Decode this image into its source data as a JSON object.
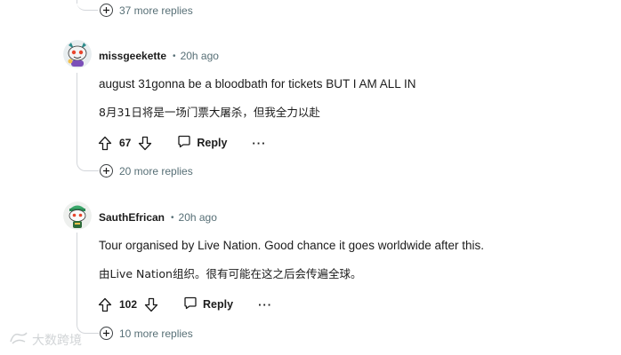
{
  "thread": {
    "top_more_replies": "37 more replies",
    "comments": [
      {
        "username": "missgeekette",
        "separator": "•",
        "time": "20h ago",
        "text": "august 31gonna be a bloodbath for tickets BUT I AM ALL IN",
        "translation": "8月31日将是一场门票大屠杀，但我全力以赴",
        "votes": "67",
        "reply_label": "Reply",
        "more_label": "···",
        "more_replies": "20 more replies",
        "avatar_color": "#2e8b8b"
      },
      {
        "username": "SauthEfrican",
        "separator": "•",
        "time": "20h ago",
        "text": "Tour organised by Live Nation. Good chance it goes worldwide after this.",
        "translation": "由Live Nation组织。很有可能在这之后会传遍全球。",
        "votes": "102",
        "reply_label": "Reply",
        "more_label": "···",
        "more_replies": "10 more replies",
        "avatar_color": "#3aa86b"
      }
    ]
  },
  "watermark": {
    "text": "大数跨境"
  }
}
